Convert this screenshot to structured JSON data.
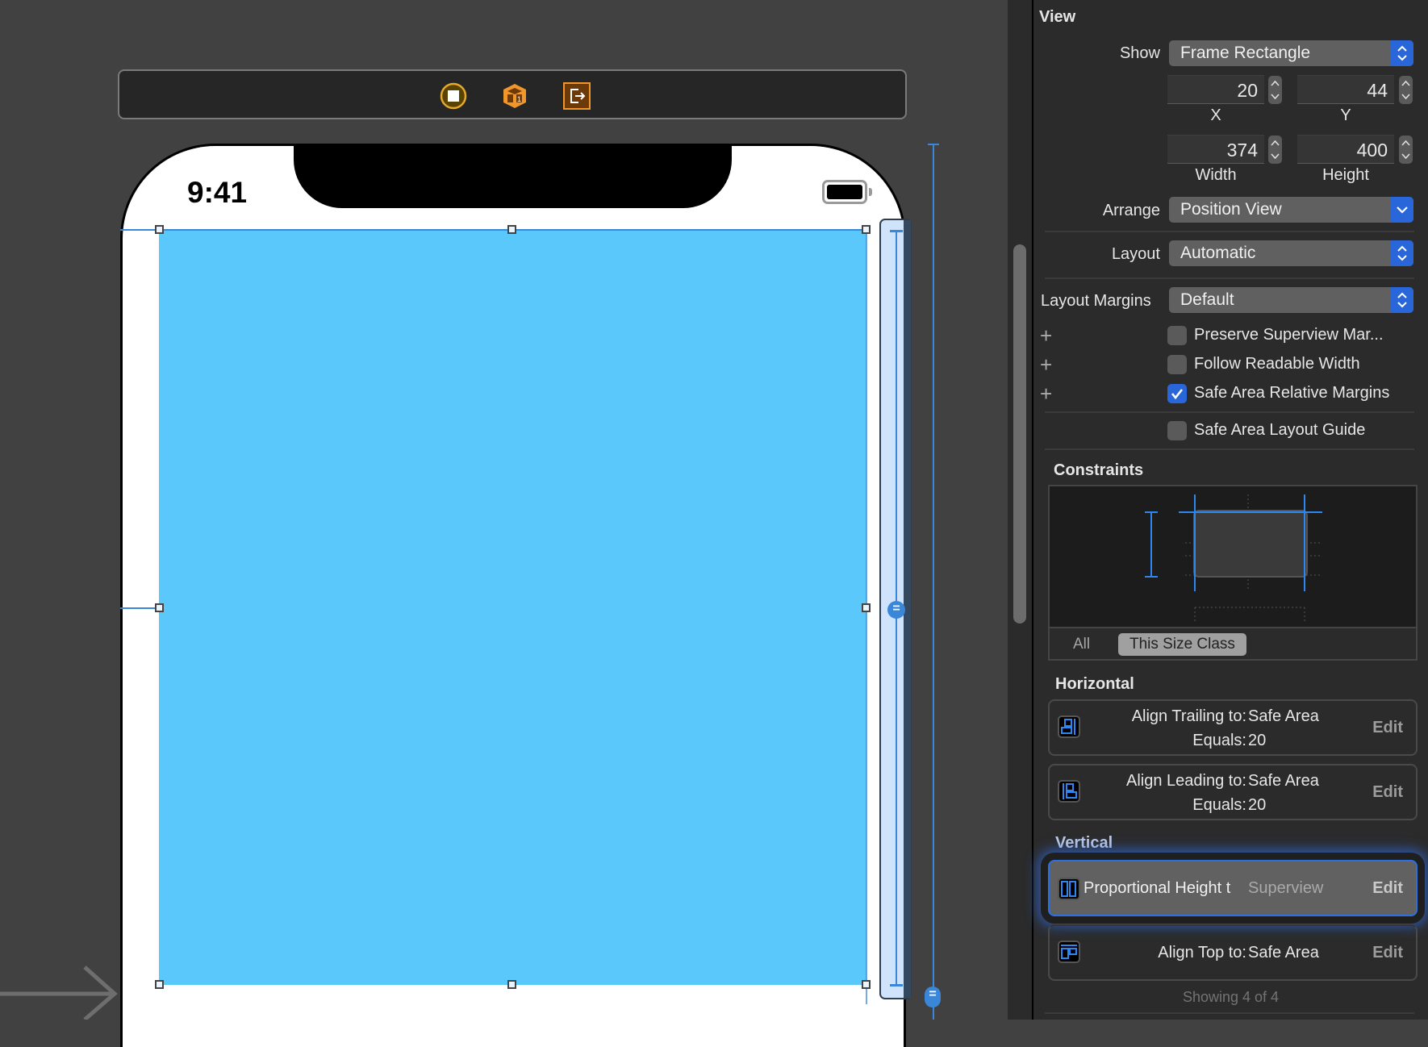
{
  "canvas": {
    "scene_dock_icons": [
      "view-controller-icon",
      "first-responder-icon",
      "exit-icon"
    ],
    "status_bar_time": "9:41",
    "view_background": "#5ac8fa",
    "constraint_badge": "="
  },
  "inspector": {
    "section_title": "View",
    "show": {
      "label": "Show",
      "value": "Frame Rectangle"
    },
    "frame": {
      "x": {
        "label": "X",
        "value": "20"
      },
      "y": {
        "label": "Y",
        "value": "44"
      },
      "width": {
        "label": "Width",
        "value": "374"
      },
      "height": {
        "label": "Height",
        "value": "400"
      }
    },
    "arrange": {
      "label": "Arrange",
      "value": "Position View"
    },
    "layout": {
      "label": "Layout",
      "value": "Automatic"
    },
    "layout_margins": {
      "label": "Layout Margins",
      "value": "Default"
    },
    "checkboxes": [
      {
        "label": "Preserve Superview Mar...",
        "checked": false,
        "has_plus": true
      },
      {
        "label": "Follow Readable Width",
        "checked": false,
        "has_plus": true
      },
      {
        "label": "Safe Area Relative Margins",
        "checked": true,
        "has_plus": true
      },
      {
        "label": "Safe Area Layout Guide",
        "checked": false,
        "has_plus": false
      }
    ],
    "constraints": {
      "title": "Constraints",
      "segments": {
        "all": "All",
        "size_class": "This Size Class"
      },
      "selected_segment": "This Size Class",
      "horizontal_title": "Horizontal",
      "horizontal": [
        {
          "icon": "align-trailing-icon",
          "relation_label": "Align Trailing to:",
          "target": "Safe Area",
          "equals_label": "Equals:",
          "constant": "20",
          "edit": "Edit"
        },
        {
          "icon": "align-leading-icon",
          "relation_label": "Align Leading to:",
          "target": "Safe Area",
          "equals_label": "Equals:",
          "constant": "20",
          "edit": "Edit"
        }
      ],
      "vertical_title": "Vertical",
      "vertical": [
        {
          "icon": "proportional-height-icon",
          "relation_label": "Proportional Height t",
          "target": "Superview",
          "edit": "Edit",
          "selected": true
        },
        {
          "icon": "align-top-icon",
          "relation_label": "Align Top to:",
          "target": "Safe Area",
          "edit": "Edit"
        }
      ],
      "footer": "Showing 4 of 4"
    }
  }
}
